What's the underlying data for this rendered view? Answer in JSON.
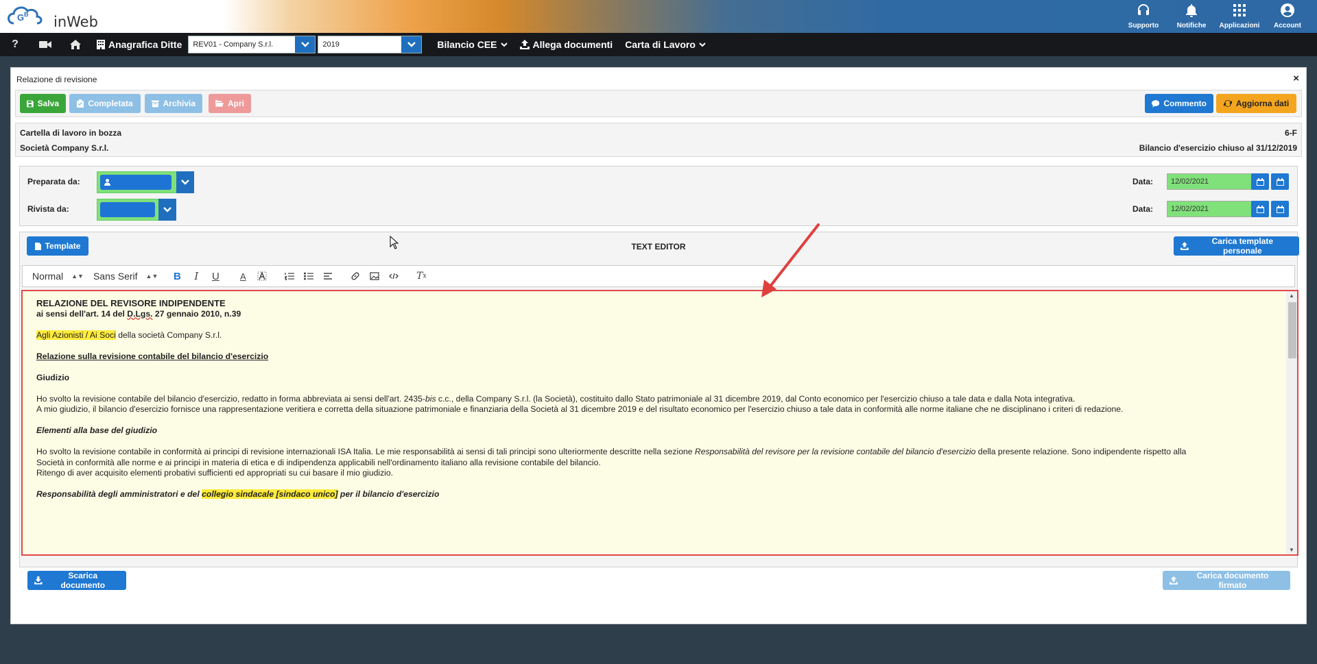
{
  "app": {
    "logo_text": "inWeb",
    "brand_color": "#2e69a5"
  },
  "top_actions": [
    {
      "label": "Supporto",
      "icon": "headset-icon"
    },
    {
      "label": "Notifiche",
      "icon": "bell-icon"
    },
    {
      "label": "Applicazioni",
      "icon": "grid-icon"
    },
    {
      "label": "Account",
      "icon": "user-circle-icon"
    }
  ],
  "navbar": {
    "help": "?",
    "anagrafica_label": "Anagrafica Ditte",
    "company_select": "REV01 - Company S.r.l.",
    "year_select": "2019",
    "bilancio_label": "Bilancio CEE",
    "allega_label": "Allega documenti",
    "carta_label": "Carta di Lavoro"
  },
  "panel": {
    "title": "Relazione di revisione",
    "close": "×",
    "toolbar": {
      "salva": "Salva",
      "completata": "Completata",
      "archivia": "Archivia",
      "apri": "Apri",
      "commento": "Commento",
      "aggiorna": "Aggiorna dati"
    },
    "info": {
      "status": "Cartella di lavoro in bozza",
      "company": "Società Company S.r.l.",
      "code": "6-F",
      "period": "Bilancio d'esercizio chiuso al 31/12/2019"
    },
    "assign": {
      "preparata_label": "Preparata da:",
      "rivista_label": "Rivista da:",
      "data_label": "Data:",
      "preparata_date": "12/02/2021",
      "rivista_date": "12/02/2021"
    },
    "editor": {
      "template_btn": "Template",
      "title": "TEXT EDITOR",
      "carica_template_btn": "Carica template personale",
      "format_select": "Normal",
      "font_select": "Sans Serif"
    },
    "footer": {
      "scarica": "Scarica documento",
      "carica_firmato": "Carica documento firmato"
    }
  },
  "document": {
    "title": "RELAZIONE DEL REVISORE INDIPENDENTE",
    "subtitle_pre": "ai sensi dell'art. 14 del ",
    "subtitle_dlgs": "D.Lgs.",
    "subtitle_post": " 27 gennaio 2010, n.39",
    "recipients_hl": "Agli Azionisti / Ai Soci",
    "recipients_rest": " della società Company S.r.l.",
    "section1": "Relazione sulla revisione contabile del bilancio d'esercizio",
    "giudizio": "Giudizio",
    "p1_pre": "Ho svolto la revisione contabile del bilancio d'esercizio, redatto in forma abbreviata ai sensi dell'art. 2435-",
    "p1_bis": "bis",
    "p1_post": " c.c., della Company S.r.l. (la Società), costituito dallo Stato patrimoniale al 31 dicembre 2019, dal Conto economico per l'esercizio chiuso a tale data e dalla Nota integrativa.",
    "p2": "A mio giudizio, il bilancio d'esercizio fornisce una rappresentazione veritiera e corretta della situazione patrimoniale e finanziaria della Società al 31 dicembre 2019 e del risultato economico per l'esercizio chiuso a tale data in conformità alle norme italiane che ne disciplinano i criteri di redazione.",
    "elementi": "Elementi alla base del giudizio",
    "p3_pre": "Ho svolto la revisione contabile in conformità ai principi di revisione internazionali ISA Italia. Le mie responsabilità ai sensi di tali principi sono ulteriormente descritte nella sezione ",
    "p3_it": "Responsabilità del revisore per la revisione contabile del bilancio d'esercizio",
    "p3_post": " della presente relazione. Sono indipendente rispetto alla",
    "p4": "Società in conformità alle norme e ai principi in materia di etica e di indipendenza applicabili nell'ordinamento italiano alla revisione contabile del bilancio.",
    "p5": "Ritengo di aver acquisito elementi probativi sufficienti ed appropriati su cui basare il mio giudizio.",
    "resp_pre": "Responsabilità degli amministratori e del ",
    "resp_hl": "collegio sindacale [sindaco unico]",
    "resp_post": " per il bilancio d'esercizio"
  }
}
